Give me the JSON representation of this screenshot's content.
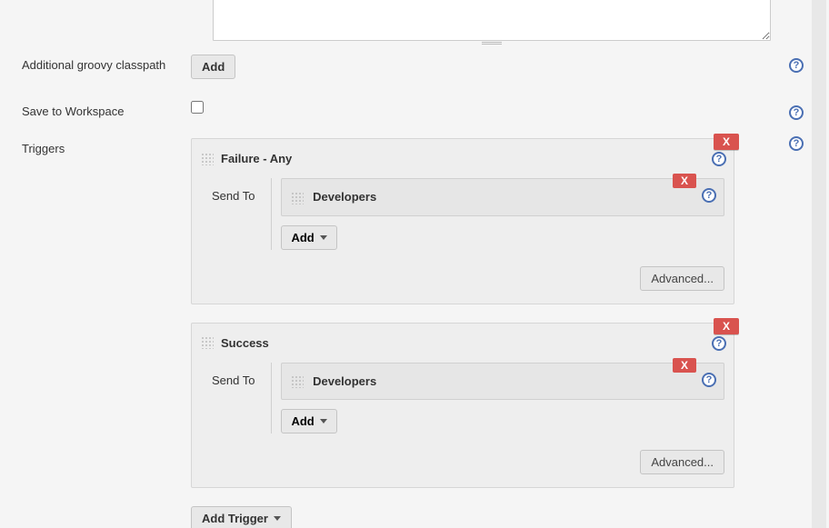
{
  "textarea": {
    "value": ""
  },
  "labels": {
    "classpath": "Additional groovy classpath",
    "save_workspace": "Save to Workspace",
    "triggers": "Triggers"
  },
  "buttons": {
    "add": "Add",
    "add_small": "Add",
    "advanced": "Advanced...",
    "add_trigger": "Add Trigger",
    "delete_x": "X"
  },
  "save_workspace_checked": false,
  "triggers": [
    {
      "title": "Failure - Any",
      "send_to_label": "Send To",
      "recipients": [
        {
          "name": "Developers"
        }
      ]
    },
    {
      "title": "Success",
      "send_to_label": "Send To",
      "recipients": [
        {
          "name": "Developers"
        }
      ]
    }
  ]
}
